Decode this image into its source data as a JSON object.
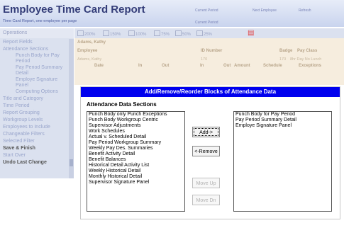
{
  "header": {
    "title": "Employee Time Card Report",
    "subtitle": "Time Card Report, one employee per page",
    "current_period_label": "Current Period",
    "current_period_value": "Current Period",
    "next_label": "Next Employee",
    "refresh_label": "Refresh"
  },
  "sidebar": {
    "title": "Operations",
    "items": [
      {
        "label": "Report Fields",
        "type": "item"
      },
      {
        "label": "Attendance Sections",
        "type": "item"
      },
      {
        "label": "Punch Body for Pay Period",
        "type": "sub"
      },
      {
        "label": "Pay Period Summary Detail",
        "type": "sub"
      },
      {
        "label": "Employe Signature Panel",
        "type": "sub"
      },
      {
        "label": "Computing Options",
        "type": "sub"
      },
      {
        "label": "Title and Category",
        "type": "item"
      },
      {
        "label": "Time Period",
        "type": "item"
      },
      {
        "label": "Report Grouping",
        "type": "item"
      },
      {
        "label": "Workgroup Levels",
        "type": "item"
      },
      {
        "label": "Employees to Include",
        "type": "item"
      },
      {
        "label": "Changeable Filters",
        "type": "item"
      },
      {
        "label": "Selected Filter",
        "type": "item"
      },
      {
        "label": "Save & Finish",
        "type": "bold"
      },
      {
        "label": "Start Over",
        "type": "item"
      },
      {
        "label": "Undo Last Change",
        "type": "bold"
      }
    ]
  },
  "toolbar": {
    "zoom_options": [
      "200%",
      "150%",
      "100%",
      "75%",
      "50%",
      "25%"
    ],
    "pdf_icon": "pdf-icon"
  },
  "report": {
    "employee_name": "Adams, Kathy",
    "employee_label": "Employee",
    "id_label": "ID Number",
    "badge_label": "Badge",
    "pay_class_label": "Pay Class",
    "employee_value": "Adams, Kathy",
    "id_value": "170",
    "badge_value": "170",
    "pay_class_value": "8hr Day No Lunch",
    "columns": [
      "Date",
      "In",
      "Out",
      "In",
      "Out",
      "Amount",
      "Schedule",
      "Exceptions"
    ]
  },
  "dialog": {
    "title": "Add/Remove/Reorder Blocks of Attendance Data",
    "section_label": "Attendance Data Sections",
    "available": [
      "Punch Body only Punch Exceptions",
      "Punch Body Workgroup Centric",
      "Supervisor Adjustments",
      "Work Schedules",
      "Actual v. Scheduled Detail",
      "Pay Period Workgroup Summary",
      "Weekly Pay Des. Summaries",
      "Benefit Activity Detail",
      "Benefit Balances",
      "Historical Detail Activity List",
      "Weekly Historical Detail",
      "Monthly Historical Detail",
      "Supervisor Signature Panel"
    ],
    "selected": [
      "Punch Body for Pay Period",
      "Pay Period Summary Detail",
      "Employe Signature Panel"
    ],
    "add_label": "Add->",
    "remove_label": "<-Remove",
    "move_up_label": "Move Up",
    "move_down_label": "Move Dn"
  }
}
